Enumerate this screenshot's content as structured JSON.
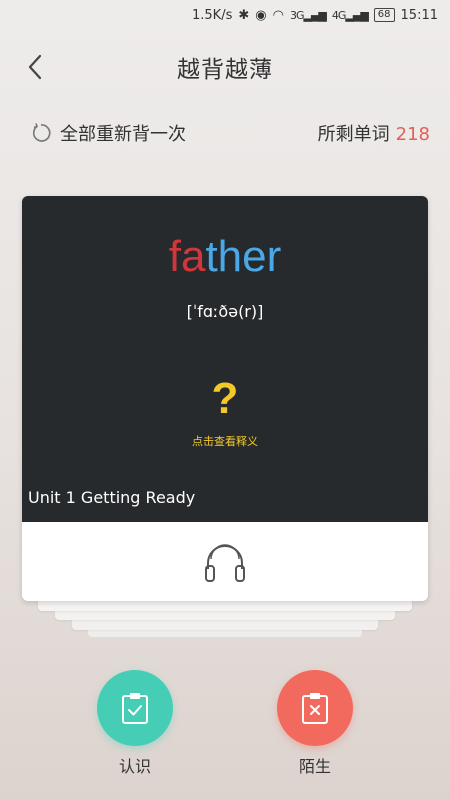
{
  "status": {
    "speed": "1.5K/s",
    "net1": "3G",
    "net2": "4G",
    "battery": "68",
    "time": "15:11"
  },
  "header": {
    "title": "越背越薄"
  },
  "toolbar": {
    "restart_label": "全部重新背一次",
    "remaining_label": "所剩单词",
    "remaining_count": "218"
  },
  "card": {
    "word_part1": "fa",
    "word_part2": "ther",
    "phonetic": "[ˈfɑːðə(r)]",
    "qmark": "?",
    "hint": "点击查看释义",
    "unit": "Unit 1 Getting Ready",
    "colors": {
      "highlight": "#d0363a",
      "rest": "#4aa8e8",
      "hint": "#f3c92a"
    }
  },
  "actions": {
    "know_label": "认识",
    "unknown_label": "陌生",
    "know_color": "#45cdb5",
    "unknown_color": "#f26a5e"
  }
}
